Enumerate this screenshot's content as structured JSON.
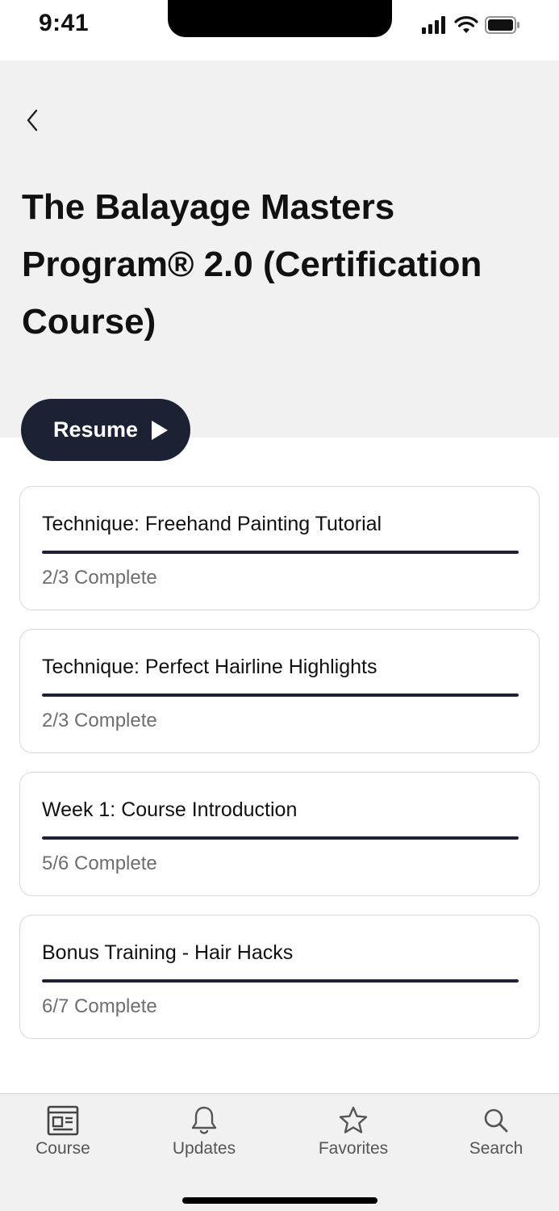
{
  "status_bar": {
    "time": "9:41"
  },
  "header": {
    "title": "The Balayage Masters Program® 2.0 (Certification Course)",
    "resume_label": "Resume"
  },
  "modules": [
    {
      "title": "Technique: Freehand Painting Tutorial",
      "status": "2/3 Complete",
      "progress": 1.0
    },
    {
      "title": "Technique: Perfect Hairline Highlights",
      "status": "2/3 Complete",
      "progress": 1.0
    },
    {
      "title": "Week 1: Course Introduction",
      "status": "5/6 Complete",
      "progress": 1.0
    },
    {
      "title": "Bonus Training - Hair Hacks",
      "status": "6/7 Complete",
      "progress": 1.0
    }
  ],
  "tab_bar": {
    "course": "Course",
    "updates": "Updates",
    "favorites": "Favorites",
    "search": "Search"
  },
  "colors": {
    "accent": "#1c2233",
    "header_bg": "#f1f1f1",
    "muted_text": "#6e6e6e"
  }
}
